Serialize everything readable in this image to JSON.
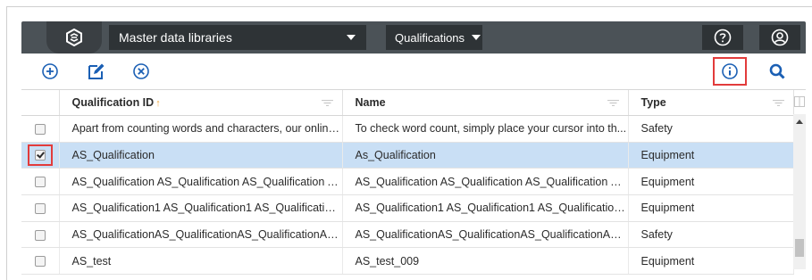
{
  "header": {
    "library_select": "Master data libraries",
    "qualifications_select": "Qualifications",
    "help_icon": "help-circle-icon",
    "user_icon": "user-circle-icon"
  },
  "toolbar": {
    "add_icon": "plus-circle-icon",
    "edit_icon": "pencil-square-icon",
    "delete_icon": "x-circle-icon",
    "info_icon": "info-circle-icon",
    "search_icon": "search-icon"
  },
  "colors": {
    "header_bg": "#4b5257",
    "select_bg": "#2e3336",
    "accent": "#1a5fb4",
    "highlight_border": "#e23b3b",
    "selected_row": "#c9dff5"
  },
  "grid": {
    "columns": [
      {
        "label": "Qualification ID",
        "sorted": "ascending"
      },
      {
        "label": "Name"
      },
      {
        "label": "Type"
      }
    ],
    "rows": [
      {
        "checked": false,
        "id": "Apart from counting words and characters, our online ...",
        "name": "To check word count, simply place your cursor into th...",
        "type": "Safety"
      },
      {
        "checked": true,
        "id": "AS_Qualification",
        "name": "As_Qualification",
        "type": "Equipment"
      },
      {
        "checked": false,
        "id": "AS_Qualification AS_Qualification AS_Qualification AS...",
        "name": "AS_Qualification AS_Qualification AS_Qualification AS...",
        "type": "Equipment"
      },
      {
        "checked": false,
        "id": "AS_Qualification1 AS_Qualification1 AS_Qualification1...",
        "name": "AS_Qualification1 AS_Qualification1 AS_Qualification1...",
        "type": "Equipment"
      },
      {
        "checked": false,
        "id": "AS_QualificationAS_QualificationAS_QualificationAS_...",
        "name": "AS_QualificationAS_QualificationAS_QualificationAS_...",
        "type": "Safety"
      },
      {
        "checked": false,
        "id": "AS_test",
        "name": "AS_test_009",
        "type": "Equipment"
      }
    ]
  }
}
